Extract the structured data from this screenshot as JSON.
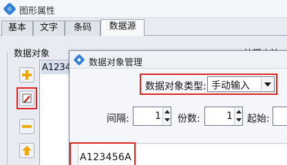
{
  "window": {
    "title": "图形属性"
  },
  "tabs": [
    {
      "label": "基本",
      "active": false
    },
    {
      "label": "文字",
      "active": false
    },
    {
      "label": "条码",
      "active": false
    },
    {
      "label": "数据源",
      "active": true
    }
  ],
  "panel": {
    "section_label": "数据对象",
    "section_label_right": "处理方法",
    "list_items": [
      "A123456A"
    ]
  },
  "side_buttons": [
    {
      "icon": "add-icon",
      "color": "#f0a800"
    },
    {
      "icon": "edit-icon",
      "color": "#c0392b"
    },
    {
      "icon": "remove-icon",
      "color": "#f0a800"
    },
    {
      "icon": "move-up-icon",
      "color": "#f0a800"
    }
  ],
  "dialog": {
    "title": "数据对象管理",
    "type_label": "数据对象类型:",
    "type_value": "手动输入",
    "interval_label": "间隔:",
    "interval_value": "1",
    "copies_label": "份数:",
    "copies_value": "1",
    "start_label": "起始:",
    "data_value": "A123456A"
  },
  "colors": {
    "highlight_red": "#e0201a",
    "selection_blue": "#d4dded",
    "accent_orange": "#f0a800"
  }
}
